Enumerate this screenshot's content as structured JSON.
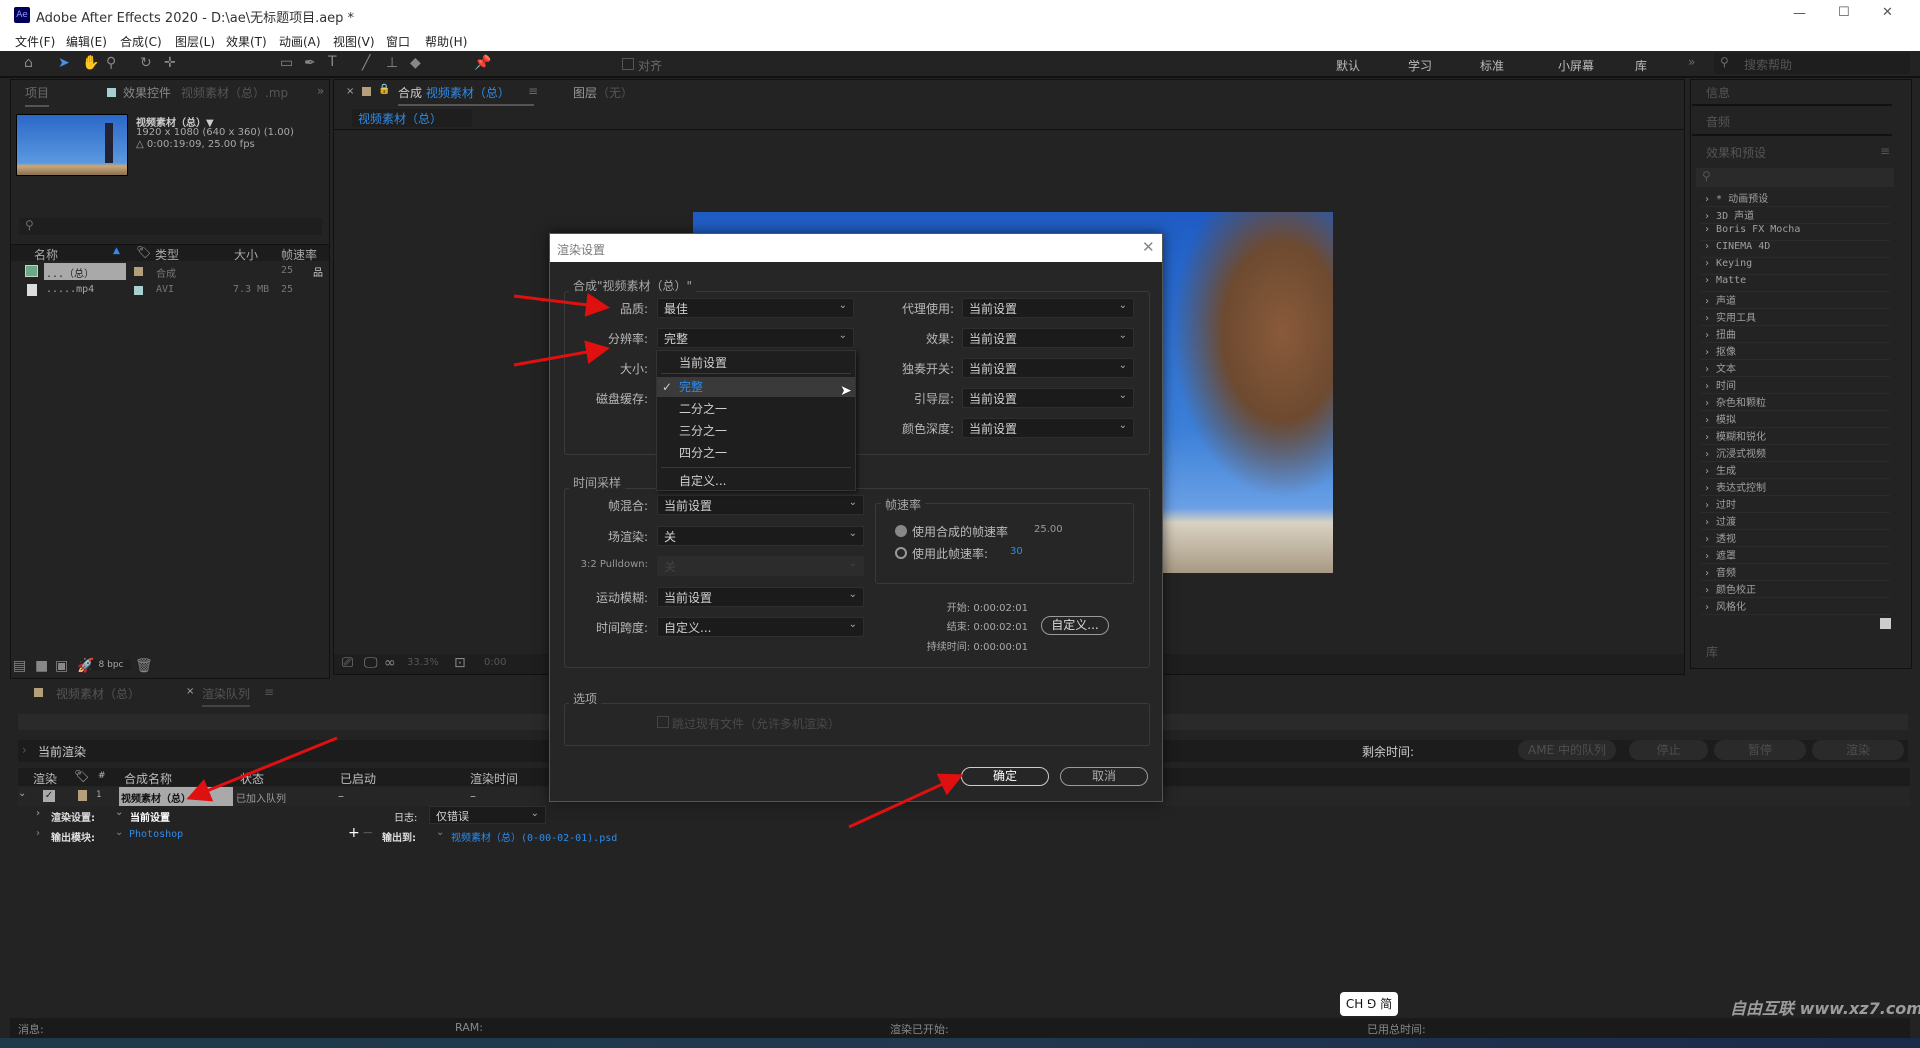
{
  "window": {
    "title": "Adobe After Effects 2020 - D:\\ae\\无标题项目.aep *",
    "app_icon": "Ae",
    "minimize": "—",
    "maximize": "☐",
    "close": "✕"
  },
  "menu": [
    "文件(F)",
    "编辑(E)",
    "合成(C)",
    "图层(L)",
    "效果(T)",
    "动画(A)",
    "视图(V)",
    "窗口",
    "帮助(H)"
  ],
  "toolbar": {
    "snap_label": "对齐",
    "workspaces": [
      "默认",
      "学习",
      "标准",
      "小屏幕",
      "库"
    ],
    "more": "»",
    "search_placeholder": "搜索帮助"
  },
  "project": {
    "tab": "项目",
    "effects_tab": "效果控件",
    "effects_tab_target": "视频素材（总）.mp",
    "more": "»",
    "selected_name": "视频素材（总）▼",
    "selected_res": "1920 x 1080  (640 x 360) (1.00)",
    "selected_dur": "△ 0:00:19:09, 25.00 fps",
    "columns": [
      "名称",
      "类型",
      "大小",
      "帧速率"
    ],
    "rows": [
      {
        "name": "...（总）",
        "type": "合成",
        "size": "",
        "fps": "25",
        "color": "#b59e7a"
      },
      {
        "name": ".....mp4",
        "type": "AVI",
        "size": "7.3 MB",
        "fps": "25",
        "color": "#a7cfcf"
      }
    ],
    "bpc": "8 bpc"
  },
  "viewer": {
    "tab_prefix": "合成",
    "tab_name": "视频素材（总）",
    "layer_tab": "图层",
    "layer_tab_value": "（无）",
    "subtab": "视频素材（总）",
    "zoom": "33.3%",
    "time": "0:00"
  },
  "right": {
    "info": "信息",
    "audio": "音频",
    "effects_presets": "效果和预设",
    "library": "库",
    "effects": [
      "* 动画预设",
      "3D 声道",
      "Boris FX Mocha",
      "CINEMA 4D",
      "Keying",
      "Matte",
      "声道",
      "实用工具",
      "扭曲",
      "抠像",
      "文本",
      "时间",
      "杂色和颗粒",
      "模拟",
      "模糊和锐化",
      "沉浸式视频",
      "生成",
      "表达式控制",
      "过时",
      "过渡",
      "透视",
      "遮罩",
      "音频",
      "颜色校正",
      "风格化"
    ]
  },
  "queue": {
    "tab_comp": "视频素材（总）",
    "tab_queue": "渲染队列",
    "current_render": "当前渲染",
    "remaining": "剩余时间:",
    "buttons": [
      "AME 中的队列",
      "停止",
      "暂停",
      "渲染"
    ],
    "columns": [
      "渲染",
      "#",
      "合成名称",
      "状态",
      "已启动",
      "渲染时间"
    ],
    "item": {
      "index": "1",
      "name": "视频素材（总）",
      "status": "已加入队列",
      "started": "–",
      "render_time": "–",
      "checked": true,
      "render_settings_label": "渲染设置:",
      "render_settings": "当前设置",
      "log_label": "日志:",
      "log": "仅错误",
      "output_module_label": "输出模块:",
      "output_module": "Photoshop",
      "output_to_label": "输出到:",
      "output_to": "视频素材（总）(0-00-02-01).psd"
    }
  },
  "status": {
    "messages": "消息:",
    "ram": "RAM:",
    "render_started": "渲染已开始:",
    "total_time": "已用总时间:",
    "ime": "CH ⅁ 简",
    "watermark": "自由互联 www.xz7.com"
  },
  "dialog": {
    "title": "渲染设置",
    "comp_group": "合成\"视频素材（总）\"",
    "quality_label": "品质:",
    "quality": "最佳",
    "resolution_label": "分辨率:",
    "resolution": "完整",
    "size_label": "大小:",
    "disk_cache_label": "磁盘缓存:",
    "proxy_label": "代理使用:",
    "proxy": "当前设置",
    "effects_label": "效果:",
    "effects": "当前设置",
    "solo_label": "独奏开关:",
    "solo": "当前设置",
    "guide_label": "引导层:",
    "guide": "当前设置",
    "depth_label": "颜色深度:",
    "depth": "当前设置",
    "resolution_options": [
      "当前设置",
      "完整",
      "二分之一",
      "三分之一",
      "四分之一",
      "自定义..."
    ],
    "resolution_selected": "完整",
    "time_group": "时间采样",
    "frame_blend_label": "帧混合:",
    "frame_blend": "当前设置",
    "field_label": "场渲染:",
    "field": "关",
    "pulldown_label": "3:2 Pulldown:",
    "pulldown": "关",
    "motion_blur_label": "运动模糊:",
    "motion_blur": "当前设置",
    "time_span_label": "时间跨度:",
    "time_span": "自定义...",
    "fps_group": "帧速率",
    "fps_comp": "使用合成的帧速率",
    "fps_comp_value": "25.00",
    "fps_custom": "使用此帧速率:",
    "fps_custom_value": "30",
    "fps_selected": "comp",
    "start": "开始: 0:00:02:01",
    "end": "结束: 0:00:02:01",
    "duration": "持续时间: 0:00:00:01",
    "custom_btn": "自定义...",
    "options_group": "选项",
    "skip_existing": "跳过现有文件（允许多机渲染）",
    "skip_checked": false,
    "ok": "确定",
    "cancel": "取消"
  },
  "colors": {
    "accent": "#2d8ceb",
    "annotation_arrow": "#e01010"
  }
}
